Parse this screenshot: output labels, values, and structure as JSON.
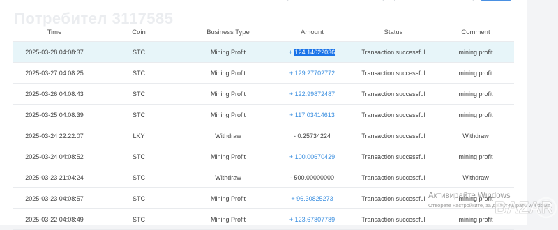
{
  "user_watermark": "Потребител 3117585",
  "columns": [
    "Time",
    "Coin",
    "Business Type",
    "Amount",
    "Status",
    "Comment"
  ],
  "rows": [
    {
      "time": "2025-03-28 04:08:37",
      "coin": "STC",
      "type": "Mining Profit",
      "amount": "+ 124.14622036",
      "status": "Transaction successful",
      "comment": "mining profit"
    },
    {
      "time": "2025-03-27 04:08:25",
      "coin": "STC",
      "type": "Mining Profit",
      "amount": "+ 129.27702772",
      "status": "Transaction successful",
      "comment": "mining profit"
    },
    {
      "time": "2025-03-26 04:08:43",
      "coin": "STC",
      "type": "Mining Profit",
      "amount": "+ 122.99872487",
      "status": "Transaction successful",
      "comment": "mining profit"
    },
    {
      "time": "2025-03-25 04:08:39",
      "coin": "STC",
      "type": "Mining Profit",
      "amount": "+ 117.03414613",
      "status": "Transaction successful",
      "comment": "mining profit"
    },
    {
      "time": "2025-03-24 22:22:07",
      "coin": "LKY",
      "type": "Withdraw",
      "amount": "- 0.25734224",
      "status": "Transaction successful",
      "comment": "Withdraw"
    },
    {
      "time": "2025-03-24 04:08:52",
      "coin": "STC",
      "type": "Mining Profit",
      "amount": "+ 100.00670429",
      "status": "Transaction successful",
      "comment": "mining profit"
    },
    {
      "time": "2025-03-23 21:04:24",
      "coin": "STC",
      "type": "Withdraw",
      "amount": "- 500.00000000",
      "status": "Transaction successful",
      "comment": "Withdraw"
    },
    {
      "time": "2025-03-23 04:08:57",
      "coin": "STC",
      "type": "Mining Profit",
      "amount": "+ 96.30825273",
      "status": "Transaction successful",
      "comment": "mining profit"
    },
    {
      "time": "2025-03-22 04:08:49",
      "coin": "STC",
      "type": "Mining Profit",
      "amount": "+ 123.67807789",
      "status": "Transaction successful",
      "comment": "mining profit"
    }
  ],
  "selected_row": 0,
  "selected_amount_sign": "+",
  "selected_amount_number": "124.14622036",
  "windows_activation": {
    "title": "Активирайте Windows",
    "subtitle": "Отворете настройките, за да активирате Windows."
  },
  "logo_text": "BAZAR",
  "colors": {
    "accent": "#3b8fe0",
    "selected_bg": "#e7f5f9",
    "highlight": "#1a73e8"
  }
}
